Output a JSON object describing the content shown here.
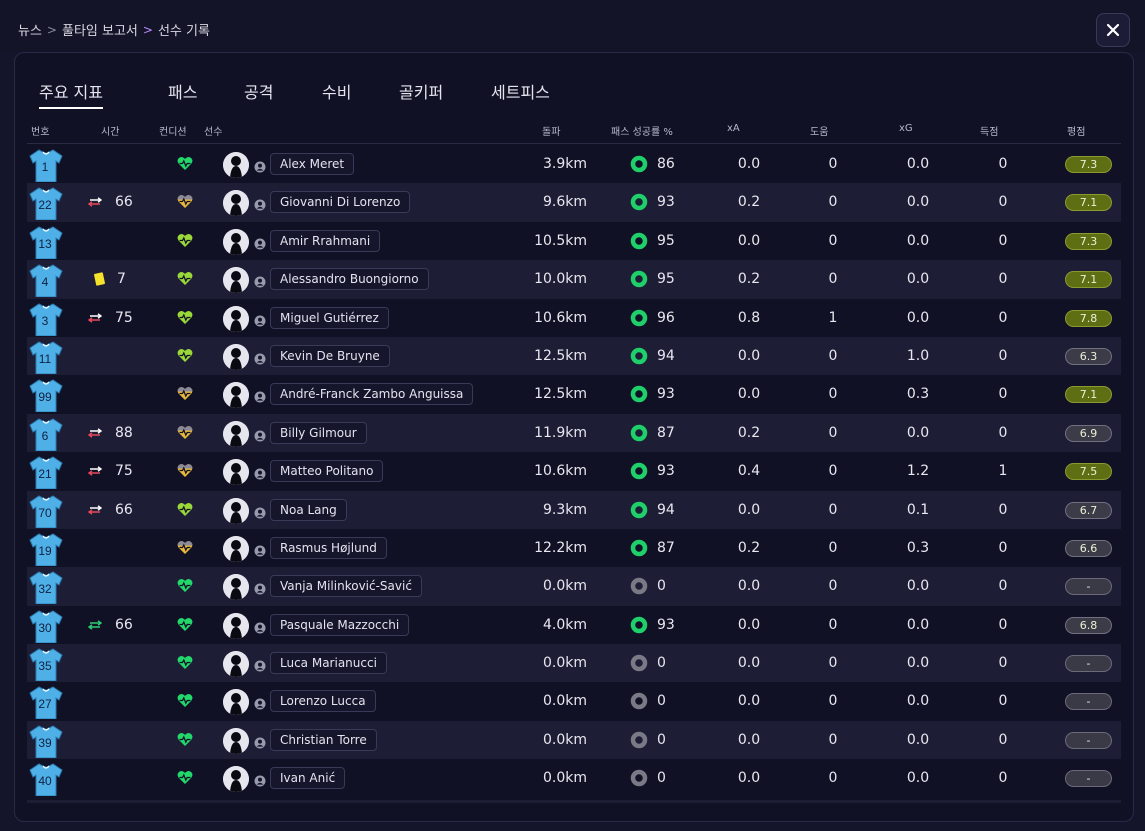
{
  "breadcrumb": [
    "뉴스",
    "풀타임 보고서",
    "선수 기록"
  ],
  "tabs": [
    {
      "label": "주요 지표",
      "active": true
    },
    {
      "label": "패스"
    },
    {
      "label": "공격"
    },
    {
      "label": "수비"
    },
    {
      "label": "골키퍼"
    },
    {
      "label": "세트피스"
    }
  ],
  "columns": {
    "number": "번호",
    "time": "시간",
    "condition": "컨디션",
    "player": "선수",
    "distance": "돌파",
    "pass_pct": "패스 성공률 %",
    "xa": "xA",
    "assists": "도움",
    "xg": "xG",
    "goals": "득점",
    "rating": "평점"
  },
  "colors": {
    "shirt": "#4fb0e8",
    "heart_green": "#23d86a",
    "heart_lime": "#9ad83a",
    "heart_amber": "#e8b83a",
    "ring_green": "#1fd06a",
    "ring_gray": "#7a7a86",
    "rating_good": "#5e6e12",
    "sub_in": "#2ecc71",
    "sub_out": "#e84a5a",
    "yellow_card": "#f5e22a"
  },
  "players": [
    {
      "num": "1",
      "event": "",
      "event_min": "",
      "cond": "green",
      "name": "Alex Meret",
      "dist": "3.9km",
      "ring": "green",
      "pct": "86",
      "xa": "0.0",
      "ast": "0",
      "xg": "0.0",
      "goals": "0",
      "rating": "7.3",
      "rclass": "good"
    },
    {
      "num": "22",
      "event": "sub",
      "event_min": "66",
      "cond": "amber",
      "name": "Giovanni Di Lorenzo",
      "dist": "9.6km",
      "ring": "green",
      "pct": "93",
      "xa": "0.2",
      "ast": "0",
      "xg": "0.0",
      "goals": "0",
      "rating": "7.1",
      "rclass": "good"
    },
    {
      "num": "13",
      "event": "",
      "event_min": "",
      "cond": "lime",
      "name": "Amir Rrahmani",
      "dist": "10.5km",
      "ring": "green",
      "pct": "95",
      "xa": "0.0",
      "ast": "0",
      "xg": "0.0",
      "goals": "0",
      "rating": "7.3",
      "rclass": "good"
    },
    {
      "num": "4",
      "event": "card",
      "event_min": "7",
      "cond": "lime",
      "name": "Alessandro Buongiorno",
      "dist": "10.0km",
      "ring": "green",
      "pct": "95",
      "xa": "0.2",
      "ast": "0",
      "xg": "0.0",
      "goals": "0",
      "rating": "7.1",
      "rclass": "good"
    },
    {
      "num": "3",
      "event": "sub",
      "event_min": "75",
      "cond": "lime",
      "name": "Miguel Gutiérrez",
      "dist": "10.6km",
      "ring": "green",
      "pct": "96",
      "xa": "0.8",
      "ast": "1",
      "xg": "0.0",
      "goals": "0",
      "rating": "7.8",
      "rclass": "good"
    },
    {
      "num": "11",
      "event": "",
      "event_min": "",
      "cond": "lime",
      "name": "Kevin De Bruyne",
      "dist": "12.5km",
      "ring": "green",
      "pct": "94",
      "xa": "0.0",
      "ast": "0",
      "xg": "1.0",
      "goals": "0",
      "rating": "6.3",
      "rclass": "mid"
    },
    {
      "num": "99",
      "event": "",
      "event_min": "",
      "cond": "amber",
      "name": "André-Franck Zambo Anguissa",
      "dist": "12.5km",
      "ring": "green",
      "pct": "93",
      "xa": "0.0",
      "ast": "0",
      "xg": "0.3",
      "goals": "0",
      "rating": "7.1",
      "rclass": "good"
    },
    {
      "num": "6",
      "event": "sub",
      "event_min": "88",
      "cond": "amber",
      "name": "Billy Gilmour",
      "dist": "11.9km",
      "ring": "green",
      "pct": "87",
      "xa": "0.2",
      "ast": "0",
      "xg": "0.0",
      "goals": "0",
      "rating": "6.9",
      "rclass": "mid"
    },
    {
      "num": "21",
      "event": "sub",
      "event_min": "75",
      "cond": "amber",
      "name": "Matteo Politano",
      "dist": "10.6km",
      "ring": "green",
      "pct": "93",
      "xa": "0.4",
      "ast": "0",
      "xg": "1.2",
      "goals": "1",
      "rating": "7.5",
      "rclass": "good"
    },
    {
      "num": "70",
      "event": "sub",
      "event_min": "66",
      "cond": "lime",
      "name": "Noa Lang",
      "dist": "9.3km",
      "ring": "green",
      "pct": "94",
      "xa": "0.0",
      "ast": "0",
      "xg": "0.1",
      "goals": "0",
      "rating": "6.7",
      "rclass": "mid"
    },
    {
      "num": "19",
      "event": "",
      "event_min": "",
      "cond": "amber",
      "name": "Rasmus Højlund",
      "dist": "12.2km",
      "ring": "green",
      "pct": "87",
      "xa": "0.2",
      "ast": "0",
      "xg": "0.3",
      "goals": "0",
      "rating": "6.6",
      "rclass": "mid"
    },
    {
      "num": "32",
      "event": "",
      "event_min": "",
      "cond": "green",
      "name": "Vanja Milinković-Savić",
      "dist": "0.0km",
      "ring": "gray",
      "pct": "0",
      "xa": "0.0",
      "ast": "0",
      "xg": "0.0",
      "goals": "0",
      "rating": "-",
      "rclass": "none"
    },
    {
      "num": "30",
      "event": "subin",
      "event_min": "66",
      "cond": "green",
      "name": "Pasquale Mazzocchi",
      "dist": "4.0km",
      "ring": "green",
      "pct": "93",
      "xa": "0.0",
      "ast": "0",
      "xg": "0.0",
      "goals": "0",
      "rating": "6.8",
      "rclass": "mid"
    },
    {
      "num": "35",
      "event": "",
      "event_min": "",
      "cond": "green",
      "name": "Luca Marianucci",
      "dist": "0.0km",
      "ring": "gray",
      "pct": "0",
      "xa": "0.0",
      "ast": "0",
      "xg": "0.0",
      "goals": "0",
      "rating": "-",
      "rclass": "none"
    },
    {
      "num": "27",
      "event": "",
      "event_min": "",
      "cond": "green",
      "name": "Lorenzo Lucca",
      "dist": "0.0km",
      "ring": "gray",
      "pct": "0",
      "xa": "0.0",
      "ast": "0",
      "xg": "0.0",
      "goals": "0",
      "rating": "-",
      "rclass": "none"
    },
    {
      "num": "39",
      "event": "",
      "event_min": "",
      "cond": "green",
      "name": "Christian Torre",
      "dist": "0.0km",
      "ring": "gray",
      "pct": "0",
      "xa": "0.0",
      "ast": "0",
      "xg": "0.0",
      "goals": "0",
      "rating": "-",
      "rclass": "none"
    },
    {
      "num": "40",
      "event": "",
      "event_min": "",
      "cond": "green",
      "name": "Ivan Anić",
      "dist": "0.0km",
      "ring": "gray",
      "pct": "0",
      "xa": "0.0",
      "ast": "0",
      "xg": "0.0",
      "goals": "0",
      "rating": "-",
      "rclass": "none"
    }
  ]
}
